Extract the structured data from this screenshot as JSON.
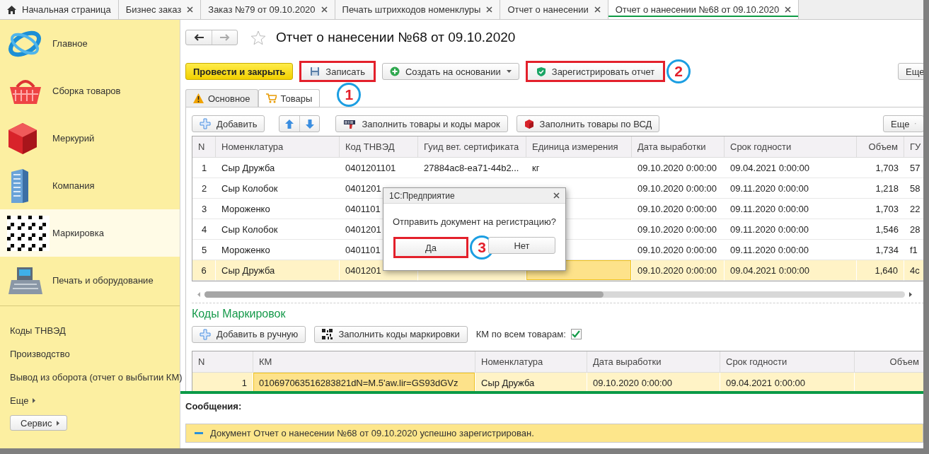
{
  "tabs": [
    {
      "label": "Начальная страница",
      "kind": "home",
      "selected": false
    },
    {
      "label": "Бизнес заказ",
      "kind": "doc",
      "selected": false
    },
    {
      "label": "Заказ №79 от 09.10.2020",
      "kind": "doc",
      "selected": false
    },
    {
      "label": "Печать штрихкодов номенклуры",
      "kind": "doc",
      "selected": false
    },
    {
      "label": "Отчет о нанесении",
      "kind": "doc",
      "selected": false
    },
    {
      "label": "Отчет о нанесении №68 от 09.10.2020",
      "kind": "doc",
      "selected": true
    }
  ],
  "sidebar": {
    "sections": [
      {
        "label": "Главное",
        "kind": "ring",
        "selected": false
      },
      {
        "label": "Сборка товаров",
        "kind": "basket",
        "selected": false
      },
      {
        "label": "Меркурий",
        "kind": "cube",
        "selected": false
      },
      {
        "label": "Компания",
        "kind": "building",
        "selected": false
      },
      {
        "label": "Маркировка",
        "kind": "qr",
        "selected": true
      },
      {
        "label": "Печать и оборудование",
        "kind": "register",
        "selected": false
      }
    ],
    "links": [
      {
        "label": "Коды ТНВЭД"
      },
      {
        "label": "Производство"
      },
      {
        "label": "Вывод из оборота (отчет о выбытии КМ)"
      }
    ],
    "more": "Еще",
    "service": "Сервис"
  },
  "form": {
    "title": "Отчет о нанесении №68 от 09.10.2020",
    "buttons": [
      {
        "label": "Провести и закрыть",
        "kind": "primary",
        "highlighted": false
      },
      {
        "label": "Записать",
        "kind": "save",
        "highlighted": true,
        "callout": "1"
      },
      {
        "label": "Создать на основании",
        "kind": "create",
        "highlighted": false
      },
      {
        "label": "Зарегистрировать отчет",
        "kind": "shield",
        "highlighted": true,
        "callout": "2"
      }
    ],
    "more": "Еще",
    "tabs": [
      {
        "label": "Основное",
        "kind": "warning",
        "selected": false
      },
      {
        "label": "Товары",
        "kind": "cart",
        "selected": true
      }
    ]
  },
  "goods": {
    "buttons": [
      {
        "label": "Добавить",
        "kind": "add"
      },
      {
        "label": "Заполнить товары и коды марок",
        "kind": "scanner"
      },
      {
        "label": "Заполнить товары по ВСД",
        "kind": "box"
      }
    ],
    "more": "Еще",
    "columns": [
      {
        "label": "N",
        "kind": "index"
      },
      {
        "label": "Номенклатура",
        "kind": "text"
      },
      {
        "label": "Код ТНВЭД",
        "kind": "text"
      },
      {
        "label": "Гуид вет. сертификата",
        "kind": "text"
      },
      {
        "label": "Единица измерения",
        "kind": "text"
      },
      {
        "label": "Дата выработки",
        "kind": "text"
      },
      {
        "label": "Срок годности",
        "kind": "text"
      },
      {
        "label": "Объем",
        "kind": "number"
      },
      {
        "label": "ГУ",
        "kind": "text"
      }
    ],
    "rows": [
      {
        "selected": false,
        "cells": [
          {
            "text": "1",
            "current": false
          },
          {
            "text": "Сыр Дружба",
            "current": false
          },
          {
            "text": "0401201101",
            "current": false
          },
          {
            "text": "27884ac8-ea71-44b2...",
            "current": false
          },
          {
            "text": "кг",
            "current": false
          },
          {
            "text": "09.10.2020 0:00:00",
            "current": false
          },
          {
            "text": "09.04.2021 0:00:00",
            "current": false
          },
          {
            "text": "1,703",
            "current": false
          },
          {
            "text": "57",
            "current": false
          }
        ]
      },
      {
        "selected": false,
        "cells": [
          {
            "text": "2",
            "current": false
          },
          {
            "text": "Сыр Колобок",
            "current": false
          },
          {
            "text": "0401201",
            "current": false
          },
          {},
          {
            "current": false
          },
          {
            "text": "09.10.2020 0:00:00",
            "current": false
          },
          {
            "text": "09.11.2020 0:00:00",
            "current": false
          },
          {
            "text": "1,218",
            "current": false
          },
          {
            "text": "58",
            "current": false
          }
        ]
      },
      {
        "selected": false,
        "cells": [
          {
            "text": "3",
            "current": false
          },
          {
            "text": "Мороженко",
            "current": false
          },
          {
            "text": "0401101",
            "current": false
          },
          {},
          {
            "current": false
          },
          {
            "text": "09.10.2020 0:00:00",
            "current": false
          },
          {
            "text": "09.11.2020 0:00:00",
            "current": false
          },
          {
            "text": "1,703",
            "current": false
          },
          {
            "text": "22",
            "current": false
          }
        ]
      },
      {
        "selected": false,
        "cells": [
          {
            "text": "4",
            "current": false
          },
          {
            "text": "Сыр Колобок",
            "current": false
          },
          {
            "text": "0401201",
            "current": false
          },
          {},
          {
            "current": false
          },
          {
            "text": "09.10.2020 0:00:00",
            "current": false
          },
          {
            "text": "09.11.2020 0:00:00",
            "current": false
          },
          {
            "text": "1,546",
            "current": false
          },
          {
            "text": "28",
            "current": false
          }
        ]
      },
      {
        "selected": false,
        "cells": [
          {
            "text": "5",
            "current": false
          },
          {
            "text": "Мороженко",
            "current": false
          },
          {
            "text": "0401101",
            "current": false
          },
          {},
          {
            "current": false
          },
          {
            "text": "09.10.2020 0:00:00",
            "current": false
          },
          {
            "text": "09.11.2020 0:00:00",
            "current": false
          },
          {
            "text": "1,734",
            "current": false
          },
          {
            "text": "f1",
            "current": false
          }
        ]
      },
      {
        "selected": true,
        "cells": [
          {
            "text": "6",
            "current": false
          },
          {
            "text": "Сыр Дружба",
            "current": false
          },
          {
            "text": "0401201",
            "current": false
          },
          {
            "current": false
          },
          {
            "current": true
          },
          {
            "text": "09.10.2020 0:00:00",
            "current": false
          },
          {
            "text": "09.04.2021 0:00:00",
            "current": false
          },
          {
            "text": "1,640",
            "current": false
          },
          {
            "text": "4c",
            "current": false
          }
        ]
      }
    ]
  },
  "marks": {
    "title": "Коды Маркировок",
    "buttons": [
      {
        "label": "Добавить в ручную",
        "kind": "add"
      },
      {
        "label": "Заполнить коды маркировки",
        "kind": "qr"
      }
    ],
    "all_goods": {
      "label": "КМ по всем товарам:",
      "checked": true
    },
    "columns": [
      {
        "label": "N",
        "kind": "index"
      },
      {
        "label": "КМ",
        "kind": "text"
      },
      {
        "label": "Номенклатура",
        "kind": "text"
      },
      {
        "label": "Дата выработки",
        "kind": "text"
      },
      {
        "label": "Срок годности",
        "kind": "text"
      },
      {
        "label": "Объем",
        "kind": "number"
      }
    ],
    "rows": [
      {
        "selected": true,
        "cells": [
          {
            "text": "1",
            "current": false
          },
          {
            "text": "010697063516283821dN=M.5'aw.lir=GS93dGVz",
            "current": true
          },
          {
            "text": "Сыр Дружба",
            "current": false
          },
          {
            "text": "09.10.2020 0:00:00",
            "current": false
          },
          {
            "text": "09.04.2021 0:00:00",
            "current": false
          },
          {
            "current": false
          }
        ]
      }
    ]
  },
  "dialog": {
    "title": "1С:Предприятие",
    "message": "Отправить документ на регистрацию?",
    "buttons": [
      {
        "label": "Да",
        "highlighted": true,
        "callout": "3"
      },
      {
        "label": "Нет",
        "highlighted": false
      }
    ]
  },
  "messages": {
    "title": "Сообщения:",
    "items": [
      {
        "text": "Документ Отчет о нанесении №68 от 09.10.2020 успешно зарегистрирован."
      }
    ]
  }
}
